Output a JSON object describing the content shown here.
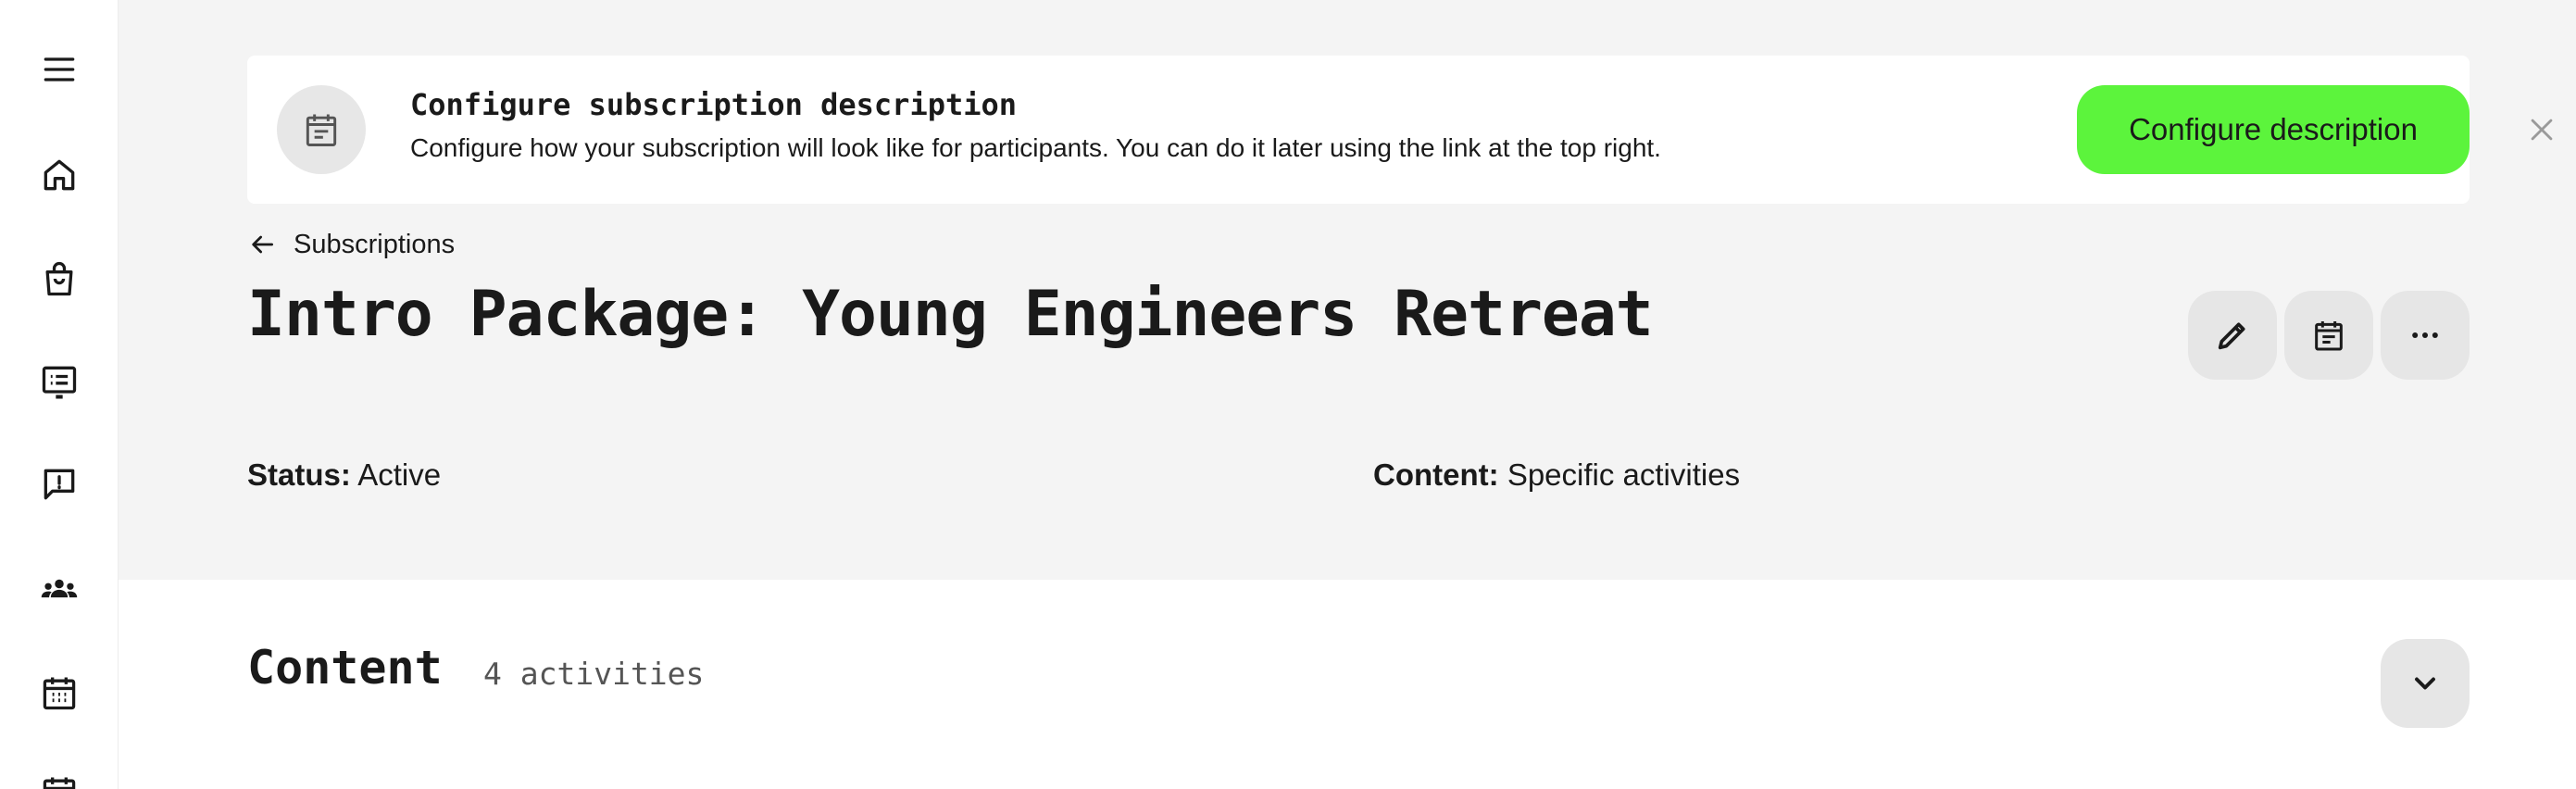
{
  "sidebar": {
    "items": [
      {
        "icon": "menu-icon"
      },
      {
        "icon": "home-icon"
      },
      {
        "icon": "shopping-bag-icon"
      },
      {
        "icon": "subscriptions-icon"
      },
      {
        "icon": "feedback-icon"
      },
      {
        "icon": "users-icon"
      },
      {
        "icon": "calendar-icon"
      },
      {
        "icon": "calendar-icon"
      }
    ]
  },
  "banner": {
    "icon": "description-icon",
    "title": "Configure subscription description",
    "text": "Configure how your subscription will look like for participants. You can do it later using the link at the top right.",
    "button_label": "Configure description",
    "close_icon": "close-icon",
    "button_color": "#5cf43c"
  },
  "breadcrumb": {
    "label": "Subscriptions",
    "icon": "arrow-left-icon"
  },
  "page": {
    "title": "Intro Package: Young Engineers Retreat"
  },
  "actions": [
    {
      "icon": "pencil-icon"
    },
    {
      "icon": "description-icon"
    },
    {
      "icon": "more-icon"
    }
  ],
  "meta": {
    "status_label": "Status:",
    "status_value": "Active",
    "content_label": "Content:",
    "content_value": "Specific activities"
  },
  "content": {
    "title": "Content",
    "count": "4 activities",
    "toggle_icon": "chevron-down-icon"
  }
}
